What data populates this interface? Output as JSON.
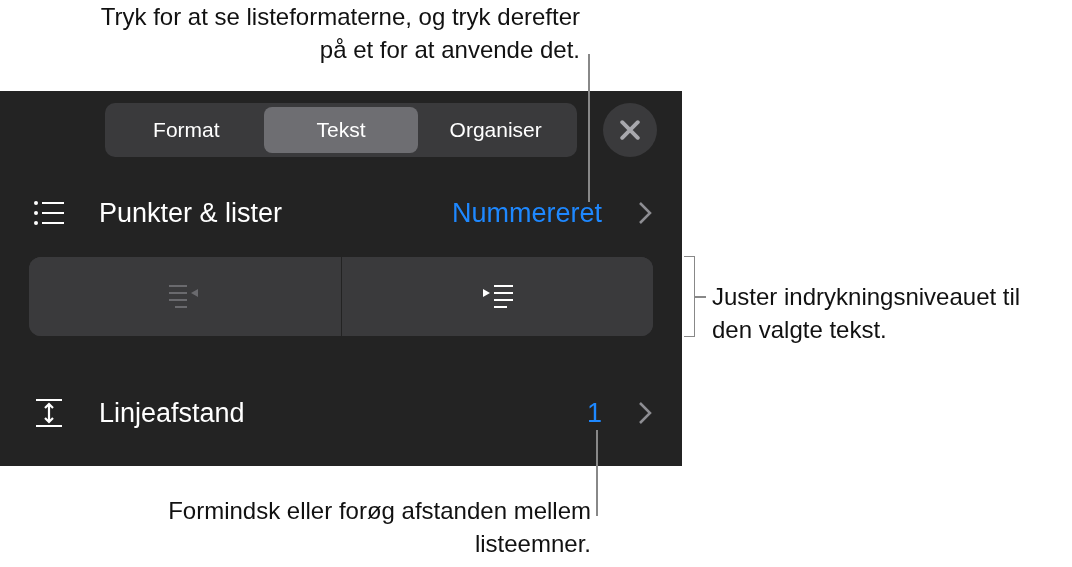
{
  "panel": {
    "tabs": [
      {
        "label": "Format",
        "selected": false
      },
      {
        "label": "Tekst",
        "selected": true
      },
      {
        "label": "Organiser",
        "selected": false
      }
    ],
    "rows": [
      {
        "kind": "value",
        "label": "Punkter & lister",
        "value": "Nummereret"
      },
      {
        "kind": "indent",
        "buttons": [
          {
            "kind": "outdent",
            "disabled": true
          },
          {
            "kind": "indent",
            "disabled": false
          }
        ]
      },
      {
        "kind": "value",
        "label": "Linjeafstand",
        "value": "1"
      }
    ]
  },
  "callouts": [
    {
      "kind": "top",
      "text": "Tryk for at se listeformaterne, og tryk derefter på et for at anvende det."
    },
    {
      "kind": "right",
      "text": "Juster indrykningsniveauet til den valgte tekst."
    },
    {
      "kind": "bottom",
      "text": "Formindsk eller forøg afstanden mellem listeemner."
    }
  ]
}
